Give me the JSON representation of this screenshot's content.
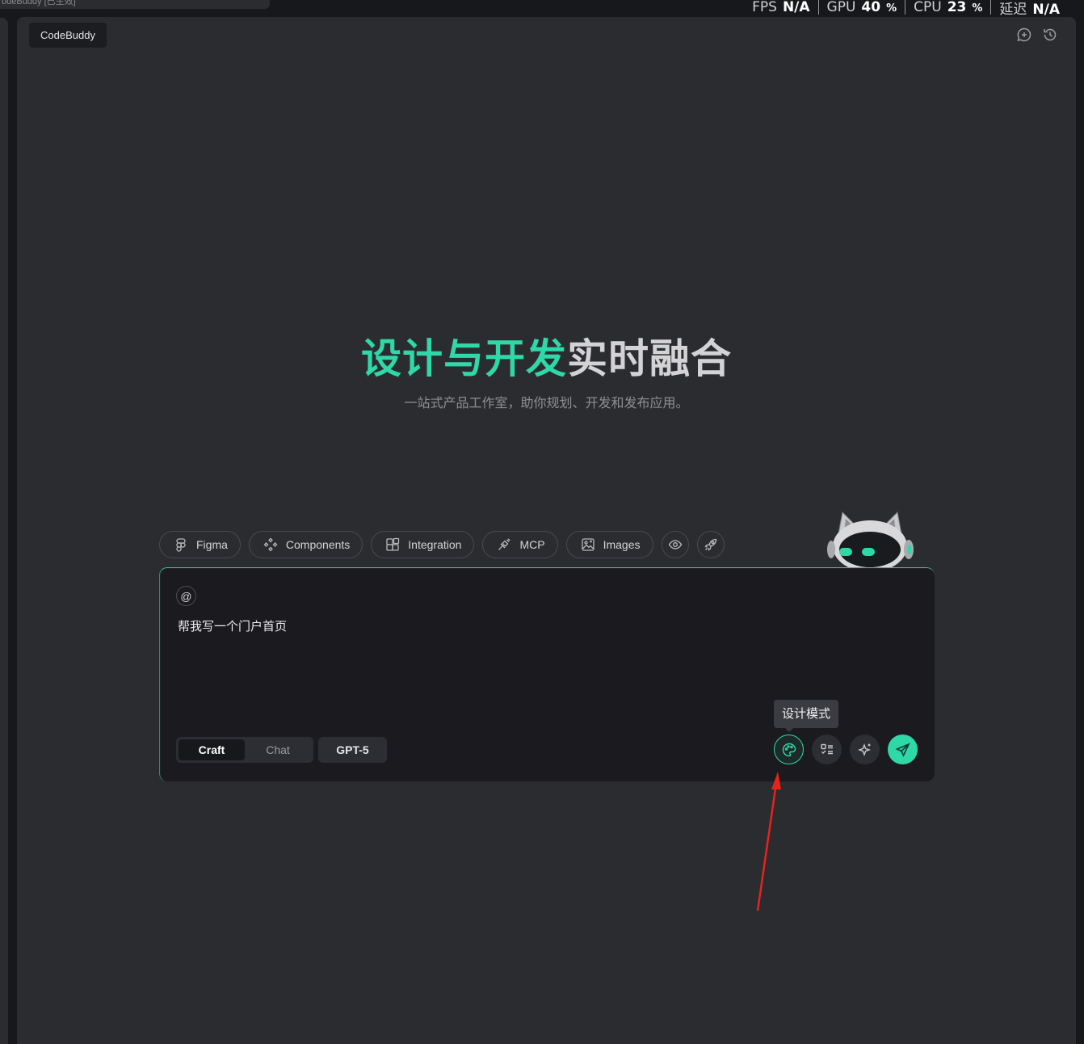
{
  "window": {
    "top_tab_text": "odeBuddy [已生效]",
    "perf": {
      "fps_label": "FPS",
      "fps_value": "N/A",
      "gpu_label": "GPU",
      "gpu_value": "40",
      "gpu_unit": "%",
      "cpu_label": "CPU",
      "cpu_value": "23",
      "cpu_unit": "%",
      "latency_label": "延迟",
      "latency_value": "N/A"
    }
  },
  "header": {
    "brand": "CodeBuddy",
    "icons": [
      "new-chat-icon",
      "history-icon"
    ]
  },
  "hero": {
    "title_accent": "设计与开发",
    "title_rest": "实时融合",
    "subtitle": "一站式产品工作室，助你规划、开发和发布应用。"
  },
  "chips": {
    "figma": "Figma",
    "components": "Components",
    "integration": "Integration",
    "mcp": "MCP",
    "images": "Images",
    "icons": [
      "figma-icon",
      "components-icon",
      "integration-icon",
      "mcp-plug-icon",
      "image-icon",
      "eye-icon",
      "rocket-icon"
    ]
  },
  "input": {
    "at_symbol": "@",
    "prompt": "帮我写一个门户首页",
    "modes": [
      "Craft",
      "Chat"
    ],
    "active_mode": "Craft",
    "model": "GPT-5",
    "tooltip": "设计模式"
  },
  "colors": {
    "accent": "#2fd8a7",
    "panel": "#2b2c30",
    "card": "#1b1b1f",
    "annotation": "#e8231c"
  }
}
